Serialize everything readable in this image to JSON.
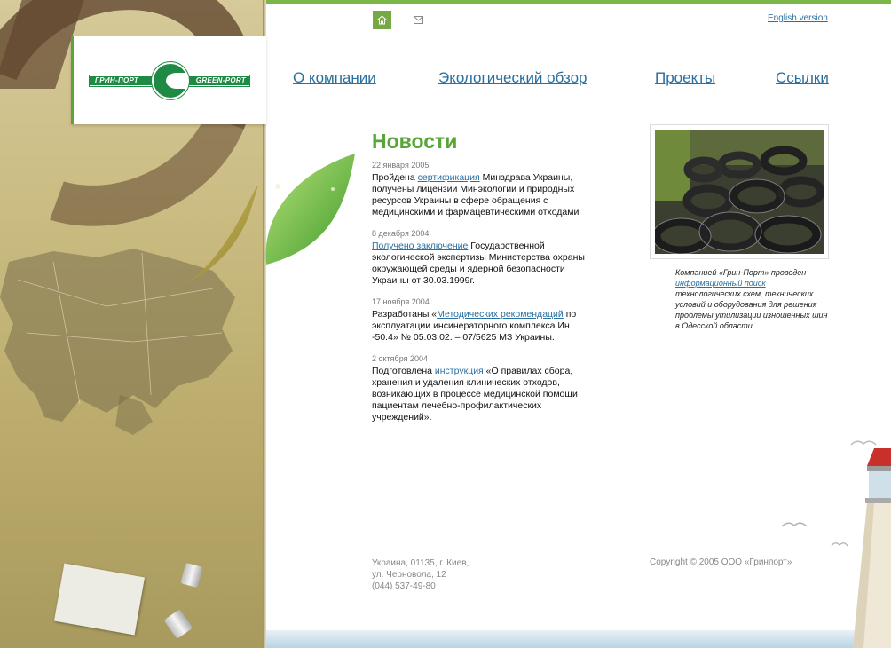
{
  "header": {
    "english_link": "English version",
    "home_icon": "home-icon",
    "mail_icon": "mail-icon"
  },
  "logo": {
    "left_text": "ГРИН-ПОРТ",
    "right_text": "GREEN-PORT"
  },
  "nav": {
    "items": [
      {
        "label": "О компании"
      },
      {
        "label": "Экологический обзор"
      },
      {
        "label": "Проекты"
      },
      {
        "label": "Ссылки"
      }
    ]
  },
  "news": {
    "title": "Новости",
    "items": [
      {
        "date": "22 января 2005",
        "before": "Пройдена ",
        "link": "сертификация",
        "after": " Минздрава Украины, получены лицензии Минэкологии и природных ресурсов Украины в сфере обращения с медицинскими и фармацевтическими  отходами"
      },
      {
        "date": "8 декабря 2004",
        "before": "",
        "link": "Получено заключение",
        "after": " Государственной экологической экспертизы Министерства охраны окружающей  среды и ядерной безопасности Украины от 30.03.1999г."
      },
      {
        "date": "17 ноября 2004",
        "before": "Разработаны «",
        "link": "Методических рекомендаций",
        "after": " по эксплуатации инсинераторного комплекса Ин -50.4»  № 05.03.02. – 07/5625 МЗ Украины."
      },
      {
        "date": "2 октября 2004",
        "before": "Подготовлена  ",
        "link": "инструкция",
        "after": " «О правилах сбора, хранения и  удаления клинических отходов, возникающих в процессе медицинской помощи пациентам лечебно-профилактических учреждений»."
      }
    ]
  },
  "photo": {
    "caption_before": "Компанией «Грин-Порт» проведен ",
    "caption_link": "информационный поиск",
    "caption_after": " технологических схем, технических условий и оборудования для решения проблемы утилизации изношенных шин в Одесской области."
  },
  "footer": {
    "address_line1": "Украина, 01135, г. Киев,",
    "address_line2": "ул. Черновола, 12",
    "address_line3": "(044) 537-49-80",
    "copyright": "Copyright © 2005 ООО «Гринпорт»"
  },
  "colors": {
    "accent_green": "#5aa53a",
    "link_blue": "#2a6fa0",
    "logo_green": "#1f8a44"
  }
}
